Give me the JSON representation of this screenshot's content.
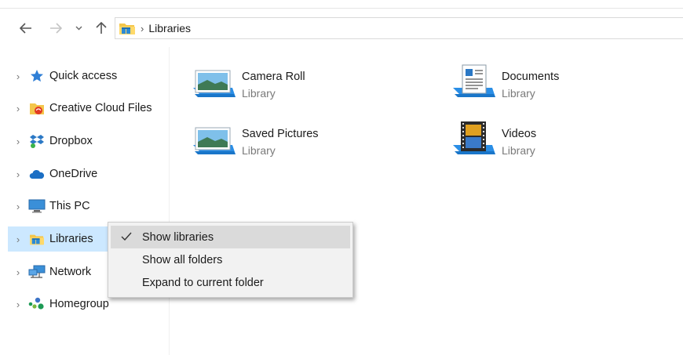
{
  "toolbar": {
    "back_icon": "back-arrow-icon",
    "forward_icon": "forward-arrow-icon",
    "recent_icon": "chevron-down-icon",
    "up_icon": "up-arrow-icon"
  },
  "address": {
    "icon": "libraries-folder-icon",
    "separator": "›",
    "crumb": "Libraries"
  },
  "nav": {
    "items": [
      {
        "label": "Quick access",
        "icon": "star-icon"
      },
      {
        "label": "Creative Cloud Files",
        "icon": "creative-cloud-icon"
      },
      {
        "label": "Dropbox",
        "icon": "dropbox-icon"
      },
      {
        "label": "OneDrive",
        "icon": "cloud-icon"
      },
      {
        "label": "This PC",
        "icon": "monitor-icon"
      },
      {
        "label": "Libraries",
        "icon": "libraries-folder-icon",
        "selected": true
      },
      {
        "label": "Network",
        "icon": "network-icon"
      },
      {
        "label": "Homegroup",
        "icon": "homegroup-icon"
      }
    ]
  },
  "libraries": [
    {
      "name": "Camera Roll",
      "type": "Library",
      "icon": "pictures-library-icon"
    },
    {
      "name": "Documents",
      "type": "Library",
      "icon": "documents-library-icon"
    },
    {
      "name": "Saved Pictures",
      "type": "Library",
      "icon": "pictures-library-icon"
    },
    {
      "name": "Videos",
      "type": "Library",
      "icon": "videos-library-icon"
    }
  ],
  "context_menu": {
    "items": [
      {
        "label": "Show libraries",
        "checked": true,
        "highlighted": true
      },
      {
        "label": "Show all folders",
        "checked": false
      },
      {
        "label": "Expand to current folder",
        "checked": false
      }
    ]
  },
  "colors": {
    "selection": "#cce8ff",
    "menu_bg": "#f2f2f2",
    "menu_highlight": "#dadada",
    "muted_text": "#7a7a7a"
  }
}
